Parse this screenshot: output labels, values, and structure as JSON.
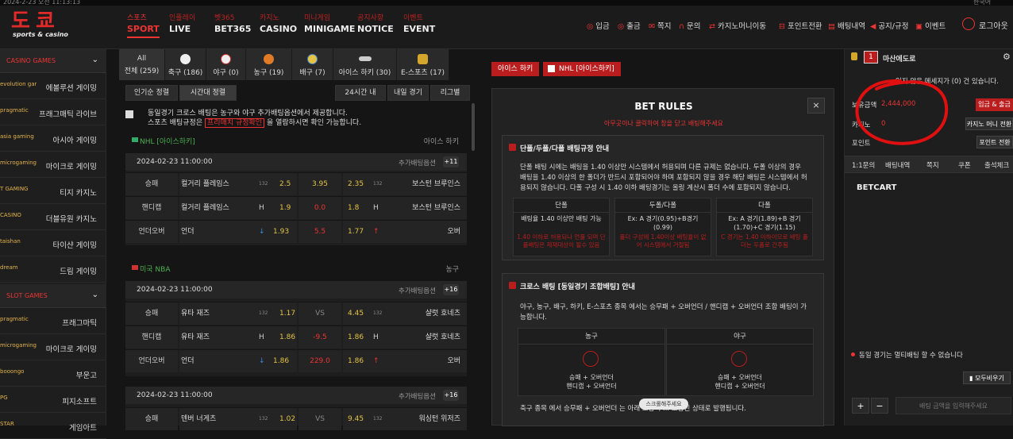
{
  "header": {
    "top_strip": {
      "left": "2024-2-23 오전 11:13:13",
      "right": "한국어"
    },
    "logo": {
      "main": "도 쿄",
      "sub": "sports & casino"
    },
    "nav": [
      {
        "ko": "스포츠",
        "en": "SPORT",
        "active": true
      },
      {
        "ko": "인플레이",
        "en": "LIVE"
      },
      {
        "ko": "벳365",
        "en": "BET365"
      },
      {
        "ko": "카지노",
        "en": "CASINO"
      },
      {
        "ko": "미니게임",
        "en": "MINIGAME"
      },
      {
        "ko": "공지사항",
        "en": "NOTICE"
      },
      {
        "ko": "이벤트",
        "en": "EVENT"
      }
    ],
    "toplinks": [
      "입금",
      "출금",
      "쪽지",
      "문의",
      "카지노머니이동",
      "포인트전환",
      "배팅내역",
      "공지/규정",
      "이벤트"
    ],
    "login": "로그아웃"
  },
  "sidebar": {
    "casino_head": "CASINO GAMES",
    "slot_head": "SLOT GAMES",
    "casino_items": [
      {
        "logo": "evolution gaming",
        "name": "에볼루션 게이밍"
      },
      {
        "logo": "pragmatic",
        "name": "프래그매틱 라이브"
      },
      {
        "logo": "asia gaming",
        "name": "아시아 게이밍"
      },
      {
        "logo": "microgaming",
        "name": "마이크로 게이밍"
      },
      {
        "logo": "T GAMING",
        "name": "티지 카지노"
      },
      {
        "logo": "CASINO",
        "name": "더블유원 카지노"
      },
      {
        "logo": "taishan",
        "name": "타이샨 게이밍"
      },
      {
        "logo": "dream",
        "name": "드림 게이밍"
      }
    ],
    "slot_items": [
      {
        "logo": "pragmatic",
        "name": "프래그마틱"
      },
      {
        "logo": "microgaming",
        "name": "마이크로 게이밍"
      },
      {
        "logo": "booongo",
        "name": "부운고"
      },
      {
        "logo": "PG",
        "name": "피지소프트"
      },
      {
        "logo": "STAR",
        "name": "게임아트"
      }
    ]
  },
  "sport_tabs": [
    {
      "label_top": "All",
      "label": "전체 (259)"
    },
    {
      "label": "축구 (186)"
    },
    {
      "label": "야구 (0)"
    },
    {
      "label": "농구 (19)"
    },
    {
      "label": "배구 (7)"
    },
    {
      "label": "아이스 하키 (30)"
    },
    {
      "label": "E-스포츠 (17)"
    }
  ],
  "filters": {
    "popular": "인기순 정렬",
    "time": "시간대 정렬",
    "h24": "24시간 내",
    "tomorrow": "내일 경기",
    "league": "리그별"
  },
  "notice": {
    "line1": "동일경기 크로스 배팅은 농구와 야구 추가배팅옵션에서 제공합니다.",
    "line2a": "스포츠 배팅규정은",
    "link": "프리매치 규정확인",
    "line2b": "을 열람하시면 확인 가능합니다."
  },
  "groups": [
    {
      "league": "NHL [아이스하키]",
      "sport": "아이스 하키",
      "date": "2024-02-23 11:00:00",
      "more": "추가배팅옵션",
      "plus": "+11",
      "rows": [
        {
          "type": "승패",
          "home": "컬거리 플레임스",
          "home_tag": "132",
          "home_val": "2.5",
          "mid": "3.95",
          "away_val": "2.35",
          "away_tag": "132",
          "away": "보스턴 브루인스"
        },
        {
          "type": "핸디캡",
          "home": "컬거리 플레임스",
          "home_tag": "H",
          "home_val": "1.9",
          "mid": "0.0",
          "away_val": "1.8",
          "away_tag": "H",
          "away": "보스턴 브루인스"
        },
        {
          "type": "언더오버",
          "home": "언더",
          "home_tag": "↓",
          "home_val": "1.93",
          "mid": "5.5",
          "away_val": "1.77",
          "away_tag": "↑",
          "away": "오버"
        }
      ]
    },
    {
      "league": "미국 NBA",
      "sport": "농구",
      "date": "2024-02-23 11:00:00",
      "more": "추가배팅옵션",
      "plus": "+16",
      "rows": [
        {
          "type": "승패",
          "home": "유타 재즈",
          "home_tag": "132",
          "home_val": "1.17",
          "mid": "VS",
          "away_val": "4.45",
          "away_tag": "132",
          "away": "샬럿 호네츠"
        },
        {
          "type": "핸디캡",
          "home": "유타 재즈",
          "home_tag": "H",
          "home_val": "1.86",
          "mid": "-9.5",
          "away_val": "1.86",
          "away_tag": "H",
          "away": "샬럿 호네츠"
        },
        {
          "type": "언더오버",
          "home": "언더",
          "home_tag": "↓",
          "home_val": "1.86",
          "mid": "229.0",
          "away_val": "1.86",
          "away_tag": "↑",
          "away": "오버"
        }
      ]
    },
    {
      "league": "",
      "sport": "",
      "date": "2024-02-23 11:00:00",
      "more": "추가배팅옵션",
      "plus": "+16",
      "rows": [
        {
          "type": "승패",
          "home": "덴버 너게츠",
          "home_tag": "132",
          "home_val": "1.02",
          "mid": "VS",
          "away_val": "9.45",
          "away_tag": "132",
          "away": "워싱턴 위저즈"
        }
      ]
    }
  ],
  "bet_header": {
    "btn1": "아이스 하키",
    "btn2": "NHL [아이스하키]"
  },
  "rules": {
    "title": "BET RULES",
    "subtitle": "아무곳이나 클릭하여 창을 닫고 배팅해주세요",
    "close": "×",
    "box1_title": "단폴/두폴/다폴 배팅규정 안내",
    "box1_text": [
      "단폴 배팅 시에는 배팅을 1.40 이상만 시스템에서 허용되며 다른 규제는 없습니다. 두폴 이상의 경우",
      "배팅을 1.40 이상의 한 폴더가 반드시 포함되어야 하며 포함되지 않을 경우 해당 배팅은 시스템에서 허",
      "용되지 않습니다. 다폴 구성 시 1.40 이하 배팅경기는 올링 계산시 폴더 수에 포함되지 않습니다."
    ],
    "cols": [
      {
        "h": "단폴",
        "b": "배팅율 1.40 이상만 배팅 가능",
        "r": "1.40 이하로 허용되나 언폴 되며 단폴배팅은 제재대상이 될수 있음"
      },
      {
        "h": "두폴/다폴",
        "b": "Ex: A 경기(0.95)+B경기(0.99)",
        "r": "폴더 구성에 1.40이상 배팅율이 없어 시스템에서 거절됨"
      },
      {
        "h": "다폴",
        "b": "Ex: A 경기(1.89)+B 경기(1.70)+C 경기(1.15)",
        "r": "C 경기는 1.40 이하이므로 배팅 폴더는 두폴로 간주됨"
      }
    ],
    "box2_title": "크로스 배팅 [동일경기 조합배팅] 안내",
    "box2_text": [
      "야구, 농구, 배구, 하키, E-스포츠 종목 에서는 승무패 + 오버언더 / 핸디캡 + 오버언더 조합 배팅이 가",
      "능합니다."
    ],
    "basketball": {
      "h": "농구",
      "l1": "승패 + 오버언더",
      "l2": "핸디캡 + 오버언더"
    },
    "baseball": {
      "h": "야구",
      "l1": "승패 + 오버언더",
      "l2": "핸디캡 + 오버언더"
    },
    "footer": "축구 종목 에서 승무패 + 오버언더 는 아래 조합시 ... 조합된 상태로 발행됩니다.",
    "scroll_hint": "스크롤해주세요"
  },
  "right": {
    "username": "마산에도로",
    "level": "1",
    "message": "읽지 않은 메세지가 (0) 건 있습니다.",
    "balance_label": "보유금액",
    "balance": "2,444,000",
    "casino_label": "카지노",
    "casino": "0",
    "point_label": "포인트",
    "btn_deposit": "입금 & 출금",
    "btn_casino": "카지노 머니 전환",
    "btn_point": "포인트 전환",
    "tabs": [
      "1:1문의",
      "배팅내역",
      "쪽지",
      "쿠폰",
      "출석체크"
    ],
    "betcart": "BETCART",
    "warn": "동일 경기는 멀티배팅 할 수 없습니다",
    "clear": "모두비우기",
    "plus": "+",
    "minus": "−",
    "amount_placeholder": "배팅 금액을 입력해주세요",
    "accent": "#e32a2a"
  }
}
